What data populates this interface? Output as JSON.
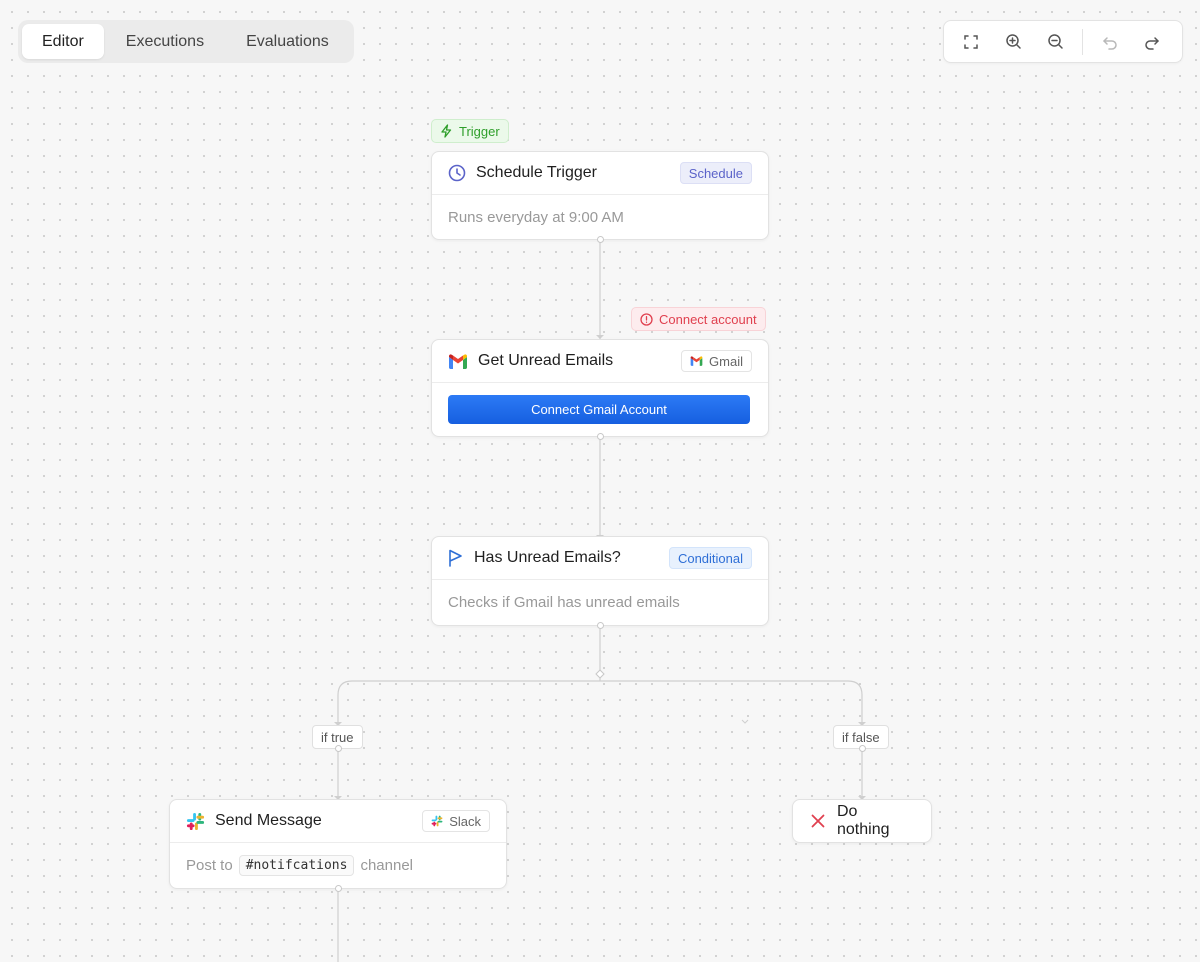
{
  "tabs": [
    {
      "label": "Editor",
      "active": true
    },
    {
      "label": "Executions",
      "active": false
    },
    {
      "label": "Evaluations",
      "active": false
    }
  ],
  "toolbar": {
    "buttons": [
      "fullscreen-icon",
      "zoom-in-icon",
      "zoom-out-icon",
      "undo-icon",
      "redo-icon"
    ]
  },
  "trigger_tag": {
    "label": "Trigger",
    "icon": "lightning-icon",
    "color": "#2e9e2a"
  },
  "schedule_node": {
    "title": "Schedule Trigger",
    "icon": "clock-icon",
    "badge": "Schedule",
    "description": "Runs everyday at 9:00 AM"
  },
  "warning_tag": {
    "label": "Connect account",
    "icon": "alert-circle-icon",
    "color": "#e0404f"
  },
  "gmail_node": {
    "title": "Get Unread Emails",
    "icon": "gmail-icon",
    "badge": "Gmail",
    "button_label": "Connect Gmail Account",
    "accent": "#1a6df0"
  },
  "conditional_node": {
    "title": "Has Unread Emails?",
    "icon": "flag-icon",
    "badge": "Conditional",
    "description": "Checks if Gmail has unread emails"
  },
  "branches": {
    "true_label": "if true",
    "false_label": "if false"
  },
  "slack_node": {
    "title": "Send Message",
    "icon": "slack-icon",
    "badge": "Slack",
    "body_prefix": "Post to",
    "channel": "#notifcations",
    "body_suffix": "channel"
  },
  "nothing_node": {
    "title": "Do nothing",
    "icon": "x-icon",
    "icon_color": "#e0404f"
  }
}
